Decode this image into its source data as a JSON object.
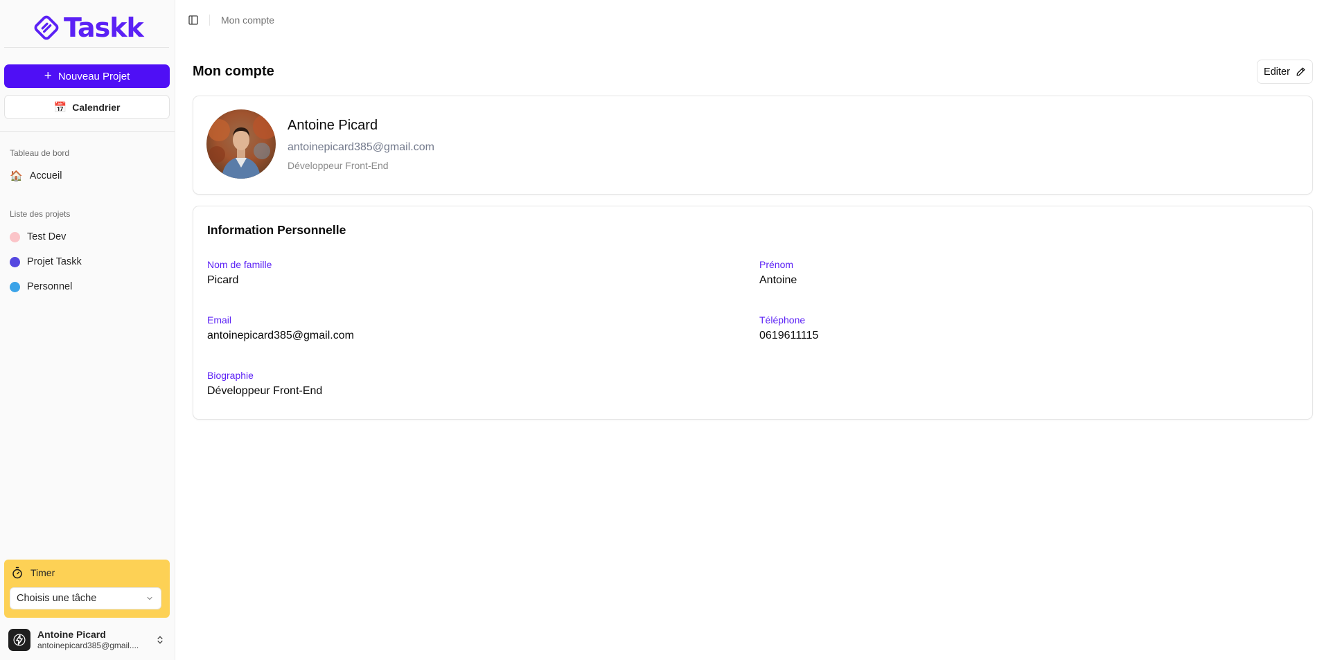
{
  "brand": {
    "name": "Taskk",
    "color": "#5b21f5"
  },
  "sidebar": {
    "new_project_label": "Nouveau Projet",
    "calendar_label": "Calendrier",
    "calendar_emoji": "📅",
    "dashboard_section": "Tableau de bord",
    "home_label": "Accueil",
    "home_emoji": "🏠",
    "projects_section": "Liste des projets",
    "projects": [
      {
        "name": "Test Dev",
        "color": "#fbc4c8"
      },
      {
        "name": "Projet Taskk",
        "color": "#5548e0"
      },
      {
        "name": "Personnel",
        "color": "#3ba3e8"
      }
    ],
    "timer": {
      "title": "Timer",
      "select_placeholder": "Choisis une tâche",
      "background": "#fdd155"
    },
    "user": {
      "name": "Antoine Picard",
      "email": "antoinepicard385@gmail...."
    }
  },
  "topbar": {
    "breadcrumb": "Mon compte"
  },
  "main": {
    "title": "Mon compte",
    "edit_label": "Editer",
    "profile": {
      "name": "Antoine Picard",
      "email": "antoinepicard385@gmail.com",
      "role": "Développeur Front-End"
    },
    "personal_info": {
      "title": "Information Personnelle",
      "fields": [
        {
          "label": "Nom de famille",
          "value": "Picard"
        },
        {
          "label": "Prénom",
          "value": "Antoine"
        },
        {
          "label": "Email",
          "value": "antoinepicard385@gmail.com"
        },
        {
          "label": "Téléphone",
          "value": "0619611115"
        },
        {
          "label": "Biographie",
          "value": "Développeur Front-End"
        }
      ]
    }
  }
}
